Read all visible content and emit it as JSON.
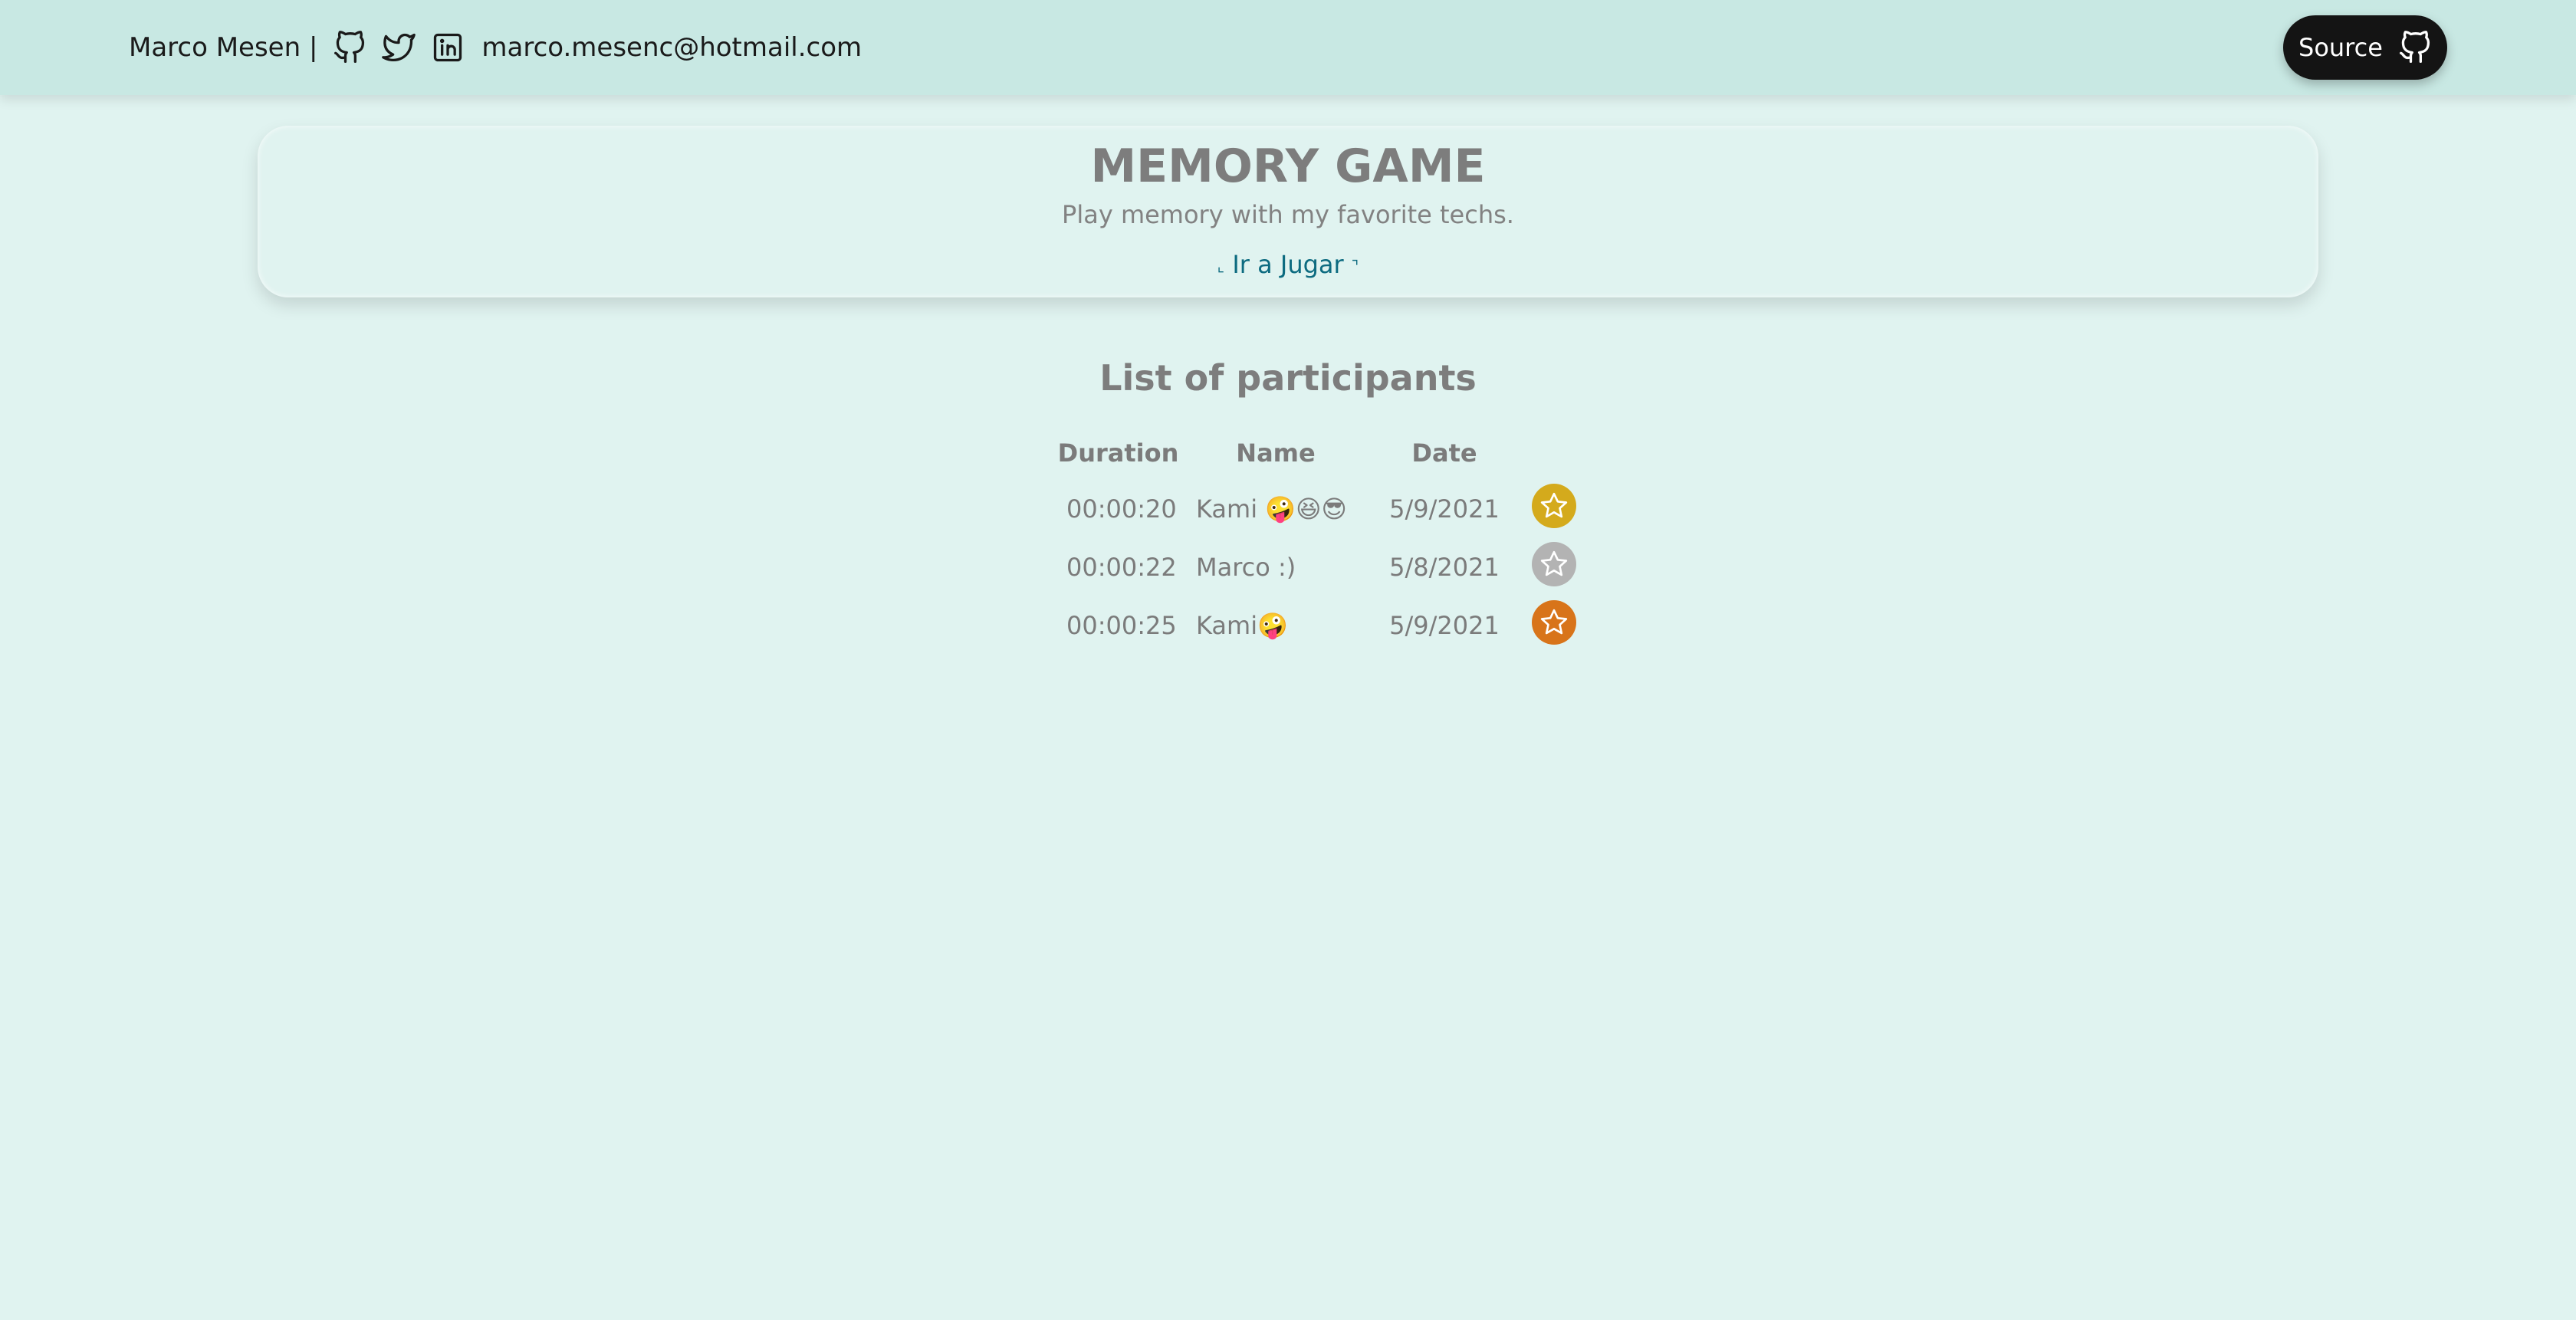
{
  "header": {
    "author_name": "Marco Mesen |",
    "email": "marco.mesenc@hotmail.com",
    "social_icons": [
      "github-icon",
      "twitter-icon",
      "linkedin-icon"
    ],
    "source_button": {
      "label": "Source",
      "icon": "github-icon"
    },
    "colors": {
      "bar": "#c8e8e3",
      "source_bg": "#141414"
    }
  },
  "hero": {
    "title": "MEMORY GAME",
    "subtitle": "Play memory with my favorite techs.",
    "link_label": "Ir a Jugar"
  },
  "participants": {
    "title": "List of participants",
    "columns": [
      "Duration",
      "Name",
      "Date"
    ],
    "rows": [
      {
        "duration": "00:00:20",
        "name": "Kami 🤪😆😎",
        "date": "5/9/2021",
        "medal": "gold",
        "medal_color": "#d4aa1c"
      },
      {
        "duration": "00:00:22",
        "name": "Marco :)",
        "date": "5/8/2021",
        "medal": "silver",
        "medal_color": "#b3b3b3"
      },
      {
        "duration": "00:00:25",
        "name": "Kami🤪",
        "date": "5/9/2021",
        "medal": "bronze",
        "medal_color": "#d8741a"
      }
    ]
  },
  "page": {
    "background": "#e0f3f0",
    "link_color": "#0d6b80"
  }
}
